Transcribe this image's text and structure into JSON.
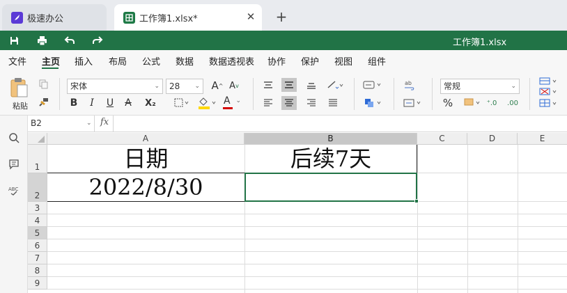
{
  "tabs": [
    {
      "label": "极速办公",
      "icon": "rocket-icon"
    },
    {
      "label": "工作簿1.xlsx*",
      "icon": "spreadsheet-icon",
      "close": "✕"
    }
  ],
  "tab_add": "+",
  "titlebar": {
    "doc_title": "工作簿1.xlsx",
    "color": "#217346"
  },
  "menu": [
    "文件",
    "主页",
    "插入",
    "布局",
    "公式",
    "数据",
    "数据透视表",
    "协作",
    "保护",
    "视图",
    "组件"
  ],
  "ribbon": {
    "paste_label": "粘贴",
    "font_name": "宋体",
    "font_size": "28",
    "number_format": "常规",
    "bold": "B",
    "italic": "I",
    "underline": "U",
    "strike": "A",
    "subscript": "X₂",
    "font_color": "A",
    "grow_font": "A",
    "shrink_font": "A",
    "percent": "%",
    "inc_decimal": "⁺.0",
    "dec_decimal": ".00"
  },
  "formula_bar": {
    "name_box": "B2",
    "fx": "fx",
    "content": ""
  },
  "grid": {
    "columns": [
      "A",
      "B",
      "C",
      "D",
      "E"
    ],
    "rows": [
      "1",
      "2",
      "3",
      "4",
      "5",
      "6",
      "7",
      "8",
      "9"
    ],
    "selected_column": "B",
    "selected_row": "2",
    "cells": {
      "A1": "日期",
      "B1": "后续7天",
      "A2": "2022/8/30",
      "B2": ""
    }
  }
}
